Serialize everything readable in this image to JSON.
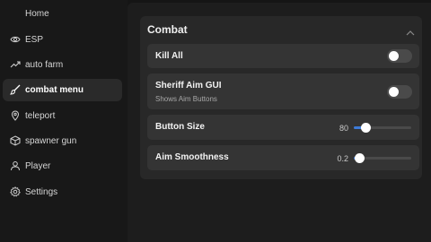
{
  "sidebar": {
    "items": [
      {
        "label": "Home",
        "icon": "home-icon"
      },
      {
        "label": "ESP",
        "icon": "eye-icon"
      },
      {
        "label": "auto farm",
        "icon": "trend-icon"
      },
      {
        "label": "combat menu",
        "icon": "brush-icon",
        "active": true
      },
      {
        "label": "teleport",
        "icon": "map-pin-icon"
      },
      {
        "label": "spawner gun",
        "icon": "cube-icon"
      },
      {
        "label": "Player",
        "icon": "user-icon"
      },
      {
        "label": "Settings",
        "icon": "gear-icon"
      }
    ]
  },
  "panel": {
    "title": "Combat",
    "rows": [
      {
        "label": "Kill All",
        "type": "toggle",
        "on": false
      },
      {
        "label": "Sheriff Aim GUI",
        "sub": "Shows Aim Buttons",
        "type": "toggle",
        "on": false
      },
      {
        "label": "Button Size",
        "type": "slider",
        "value": "80",
        "fraction": 0.2
      },
      {
        "label": "Aim Smoothness",
        "type": "slider",
        "value": "0.2",
        "fraction": 0.1
      }
    ]
  },
  "colors": {
    "accent": "#3d7bd9",
    "background": "#151515",
    "panel": "#282828",
    "row": "#343434"
  }
}
